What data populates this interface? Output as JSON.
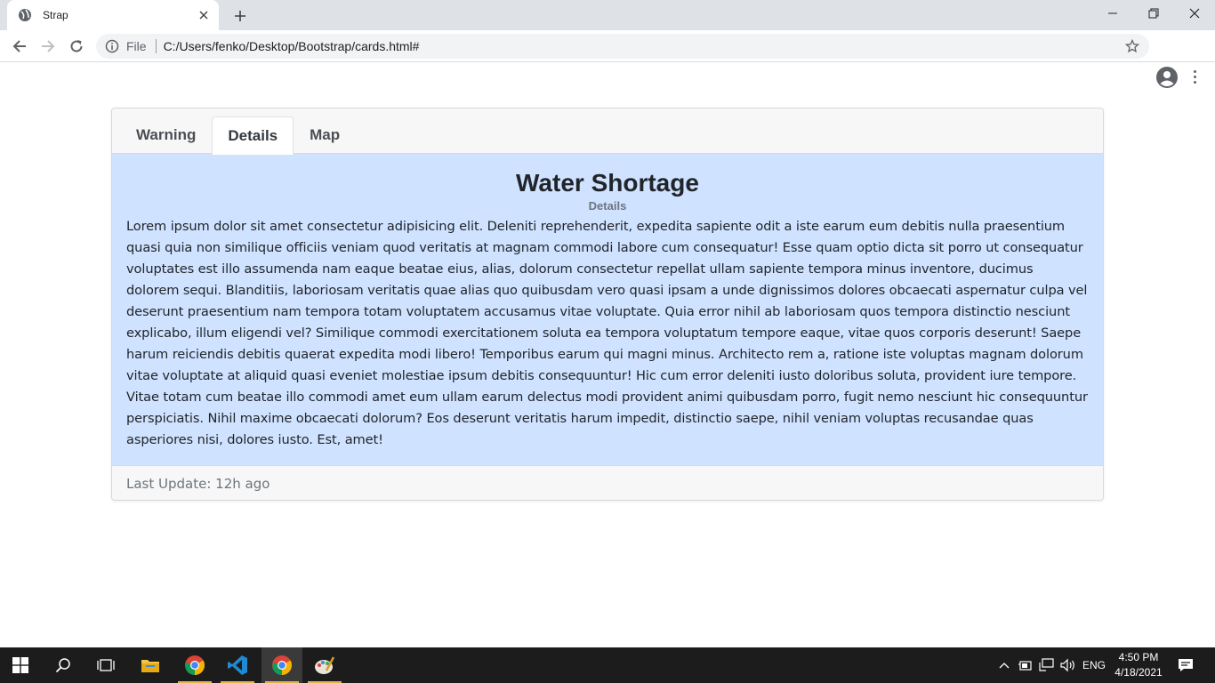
{
  "browser": {
    "tab_title": "Strap",
    "omnibox": {
      "scheme_label": "File",
      "url": "C:/Users/fenko/Desktop/Bootstrap/cards.html#"
    }
  },
  "card": {
    "tabs": [
      {
        "label": "Warning",
        "active": false
      },
      {
        "label": "Details",
        "active": true
      },
      {
        "label": "Map",
        "active": false
      }
    ],
    "title": "Water Shortage",
    "subtitle": "Details",
    "text": "Lorem ipsum dolor sit amet consectetur adipisicing elit. Deleniti reprehenderit, expedita sapiente odit a iste earum eum debitis nulla praesentium quasi quia non similique officiis veniam quod veritatis at magnam commodi labore cum consequatur! Esse quam optio dicta sit porro ut consequatur voluptates est illo assumenda nam eaque beatae eius, alias, dolorum consectetur repellat ullam sapiente tempora minus inventore, ducimus dolorem sequi. Blanditiis, laboriosam veritatis quae alias quo quibusdam vero quasi ipsam a unde dignissimos dolores obcaecati aspernatur culpa vel deserunt praesentium nam tempora totam voluptatem accusamus vitae voluptate. Quia error nihil ab laboriosam quos tempora distinctio nesciunt explicabo, illum eligendi vel? Similique commodi exercitationem soluta ea tempora voluptatum tempore eaque, vitae quos corporis deserunt! Saepe harum reiciendis debitis quaerat expedita modi libero! Temporibus earum qui magni minus. Architecto rem a, ratione iste voluptas magnam dolorum vitae voluptate at aliquid quasi eveniet molestiae ipsum debitis consequuntur! Hic cum error deleniti iusto doloribus soluta, provident iure tempore. Vitae totam cum beatae illo commodi amet eum ullam earum delectus modi provident animi quibusdam porro, fugit nemo nesciunt hic consequuntur perspiciatis. Nihil maxime obcaecati dolorum? Eos deserunt veritatis harum impedit, distinctio saepe, nihil veniam voluptas recusandae quas asperiores nisi, dolores iusto. Est, amet!",
    "footer": "Last Update: 12h ago"
  },
  "taskbar": {
    "apps": [
      "start-icon",
      "search-icon",
      "task-view-icon",
      "file-explorer-icon",
      "chrome-icon",
      "vscode-icon",
      "chrome-active-icon",
      "paint-icon"
    ],
    "language": "ENG",
    "time": "4:50 PM",
    "date": "4/18/2021"
  },
  "colors": {
    "card_body_bg": "#cfe2ff",
    "taskbar_bg": "#1c1c1c",
    "tabstrip_bg": "#dee1e6"
  }
}
